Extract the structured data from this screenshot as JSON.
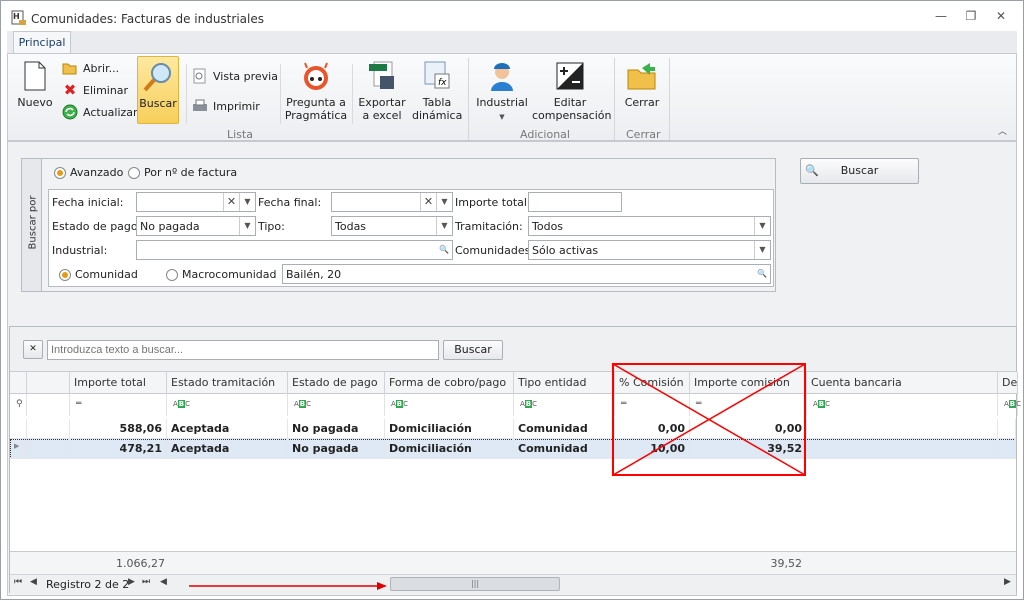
{
  "window": {
    "title": "Comunidades: Facturas de industriales",
    "app_icon": "document-ledger-icon",
    "controls": [
      "minimize",
      "restore",
      "close"
    ]
  },
  "ribbon": {
    "tabs": [
      {
        "label": "Principal",
        "active": true
      }
    ],
    "groups": [
      {
        "label": "Lista",
        "items": [
          {
            "label": "Nuevo",
            "icon": "new-document-icon"
          },
          {
            "label": "Abrir...",
            "icon": "folder-open-icon"
          },
          {
            "label": "Eliminar",
            "icon": "delete-x-icon"
          },
          {
            "label": "Actualizar",
            "icon": "refresh-icon"
          },
          {
            "label": "Buscar",
            "icon": "magnifier-icon",
            "active": true
          },
          {
            "label": "Vista previa",
            "icon": "print-preview-icon"
          },
          {
            "label": "Imprimir",
            "icon": "printer-icon"
          },
          {
            "label": "Pregunta a Pragmática",
            "line1": "Pregunta a",
            "line2": "Pragmática",
            "icon": "pragmatica-robot-icon"
          },
          {
            "label": "Exportar a excel",
            "line1": "Exportar",
            "line2": "a excel",
            "icon": "excel-export-icon"
          },
          {
            "label": "Tabla dinámica",
            "line1": "Tabla",
            "line2": "dinámica",
            "icon": "pivot-table-icon"
          }
        ]
      },
      {
        "label": "Adicional",
        "items": [
          {
            "label": "Industrial",
            "icon": "worker-icon",
            "dropdown": true
          },
          {
            "label": "Editar compensación",
            "line1": "Editar",
            "line2": "compensación",
            "icon": "plus-minus-icon"
          }
        ]
      },
      {
        "label": "Cerrar",
        "items": [
          {
            "label": "Cerrar",
            "icon": "exit-folder-icon"
          }
        ]
      }
    ]
  },
  "search_panel": {
    "side_label": "Buscar por",
    "modes": [
      {
        "label": "Avanzado",
        "selected": true
      },
      {
        "label": "Por nº de factura",
        "selected": false
      }
    ],
    "fields": {
      "fecha_inicial": {
        "label": "Fecha inicial:",
        "value": ""
      },
      "fecha_final": {
        "label": "Fecha final:",
        "value": ""
      },
      "importe_total": {
        "label": "Importe total:",
        "value": ""
      },
      "estado_pago": {
        "label": "Estado de pago:",
        "value": "No pagada"
      },
      "tipo": {
        "label": "Tipo:",
        "value": "Todas"
      },
      "tramitacion": {
        "label": "Tramitación:",
        "value": "Todos"
      },
      "industrial": {
        "label": "Industrial:",
        "value": ""
      },
      "comunidades": {
        "label": "Comunidades:",
        "value": "Sólo activas"
      },
      "scope": [
        {
          "label": "Comunidad",
          "selected": true
        },
        {
          "label": "Macrocomunidad",
          "selected": false
        }
      ],
      "comunidad_value": "Bailén, 20"
    },
    "search_button": "Buscar"
  },
  "grid": {
    "find_placeholder": "Introduzca texto a buscar...",
    "find_button": "Buscar",
    "columns": [
      "Importe total",
      "Estado tramitación",
      "Estado de pago",
      "Forma de cobro/pago",
      "Tipo entidad",
      "% Comisión",
      "Importe comisión",
      "Cuenta bancaria",
      "De"
    ],
    "rows": [
      [
        "588,06",
        "Aceptada",
        "No pagada",
        "Domiciliación",
        "Comunidad",
        "0,00",
        "0,00",
        ""
      ],
      [
        "478,21",
        "Aceptada",
        "No pagada",
        "Domiciliación",
        "Comunidad",
        "10,00",
        "39,52",
        ""
      ]
    ],
    "selected_row": 1,
    "totals": {
      "importe_total": "1.066,27",
      "importe_comision": "39,52"
    },
    "status": "Registro 2 de 2"
  },
  "annotations": {
    "color": "#ff0000",
    "crossed_columns": [
      "% Comisión",
      "Importe comisión"
    ],
    "arrow": "points to horizontal scrollbar"
  }
}
